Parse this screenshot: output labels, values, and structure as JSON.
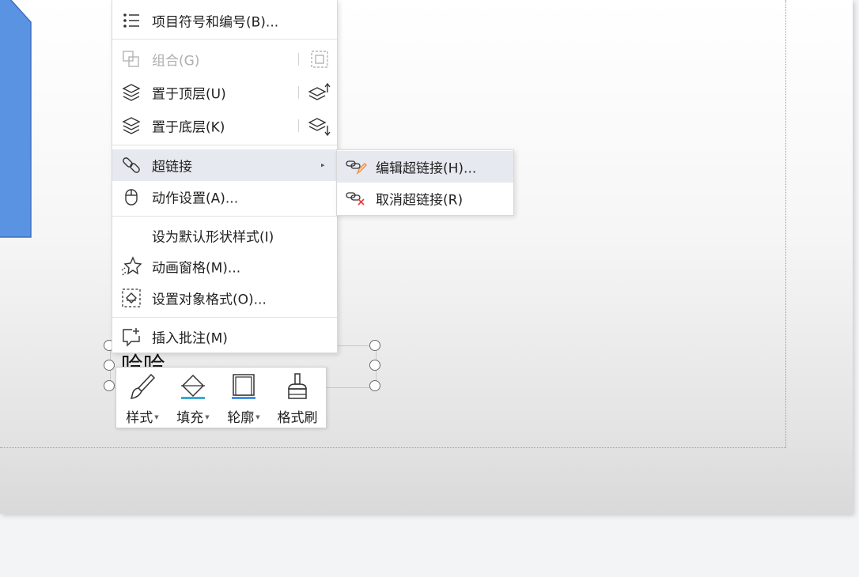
{
  "context_menu": {
    "items": [
      {
        "label": "项目符号和编号(B)...",
        "icon": "bullet-list-icon"
      },
      {
        "label": "组合(G)",
        "icon": "group-icon",
        "disabled": true,
        "shortcut_icon": "group-shortcut-icon"
      },
      {
        "label": "置于顶层(U)",
        "icon": "layers-icon",
        "shortcut_icon": "bring-to-front-icon"
      },
      {
        "label": "置于底层(K)",
        "icon": "layers-icon",
        "shortcut_icon": "send-to-back-icon"
      },
      {
        "label": "超链接",
        "icon": "link-icon",
        "has_submenu": true
      },
      {
        "label": "动作设置(A)...",
        "icon": "mouse-icon"
      },
      {
        "label": "设为默认形状样式(I)"
      },
      {
        "label": "动画窗格(M)...",
        "icon": "animation-star-icon"
      },
      {
        "label": "设置对象格式(O)...",
        "icon": "format-object-icon"
      },
      {
        "label": "插入批注(M)",
        "icon": "add-comment-icon"
      }
    ]
  },
  "submenu": {
    "items": [
      {
        "label": "编辑超链接(H)...",
        "icon": "edit-link-icon"
      },
      {
        "label": "取消超链接(R)",
        "icon": "remove-link-icon"
      }
    ]
  },
  "text_box": {
    "text": "哈哈"
  },
  "mini_toolbar": {
    "tools": [
      {
        "label": "样式",
        "icon": "brush-icon",
        "dropdown": true
      },
      {
        "label": "填充",
        "icon": "fill-icon",
        "dropdown": true
      },
      {
        "label": "轮廓",
        "icon": "outline-icon",
        "dropdown": true
      },
      {
        "label": "格式刷",
        "icon": "format-painter-icon",
        "dropdown": false
      }
    ]
  },
  "colors": {
    "shape_fill": "#5b93e3",
    "shape_border": "#3e6fc0",
    "menu_highlight": "#e6e9ef",
    "fill_accent": "#3fa7d6",
    "outline_accent": "#4a90e2",
    "unlink_red": "#e53935",
    "edit_orange": "#f28c38"
  }
}
